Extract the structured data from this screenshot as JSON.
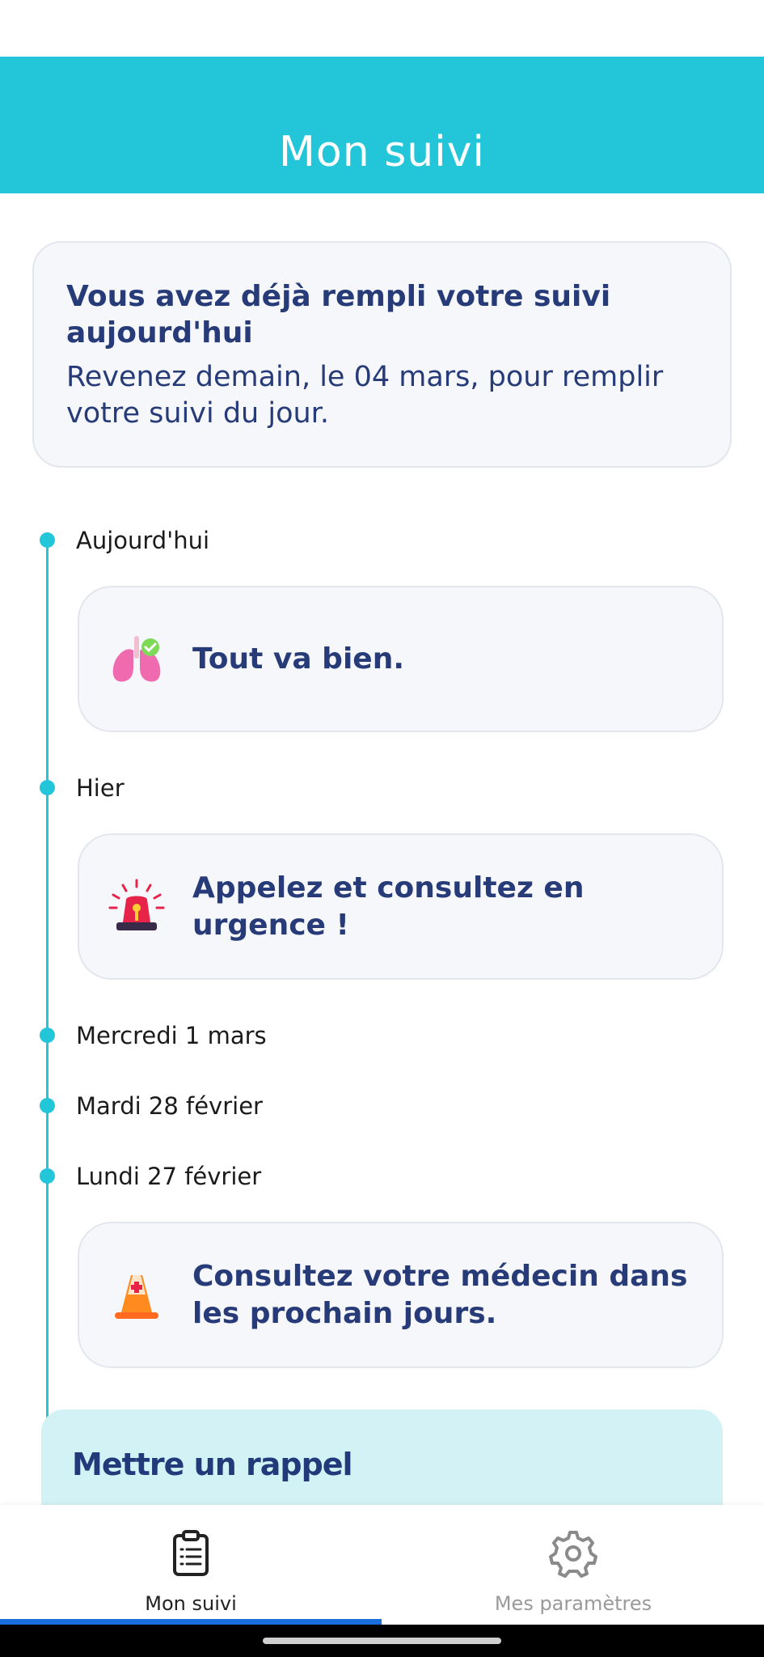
{
  "header": {
    "title": "Mon suivi"
  },
  "info_card": {
    "title": "Vous avez déjà rempli votre suivi aujourd'hui",
    "text": "Revenez demain, le 04 mars, pour remplir votre suivi du jour."
  },
  "timeline": [
    {
      "day": "Aujourd'hui",
      "status": "Tout va bien.",
      "icon": "lungs-check-icon"
    },
    {
      "day": "Hier",
      "status": "Appelez et consultez en urgence !",
      "icon": "emergency-siren-icon"
    },
    {
      "day": "Mercredi 1 mars"
    },
    {
      "day": "Mardi 28 février"
    },
    {
      "day": "Lundi 27 février",
      "status": "Consultez votre médecin dans les prochain jours.",
      "icon": "medical-cone-icon"
    }
  ],
  "reminder": {
    "title": "Mettre un rappel"
  },
  "bottom_nav": {
    "tabs": [
      {
        "label": "Mon suivi",
        "icon": "clipboard-icon",
        "active": true
      },
      {
        "label": "Mes paramètres",
        "icon": "gear-icon",
        "active": false
      }
    ]
  },
  "colors": {
    "accent": "#22c6d8",
    "primary_text": "#263b78",
    "card_bg": "#f6f7fa",
    "active_indicator": "#1a6fdc"
  }
}
